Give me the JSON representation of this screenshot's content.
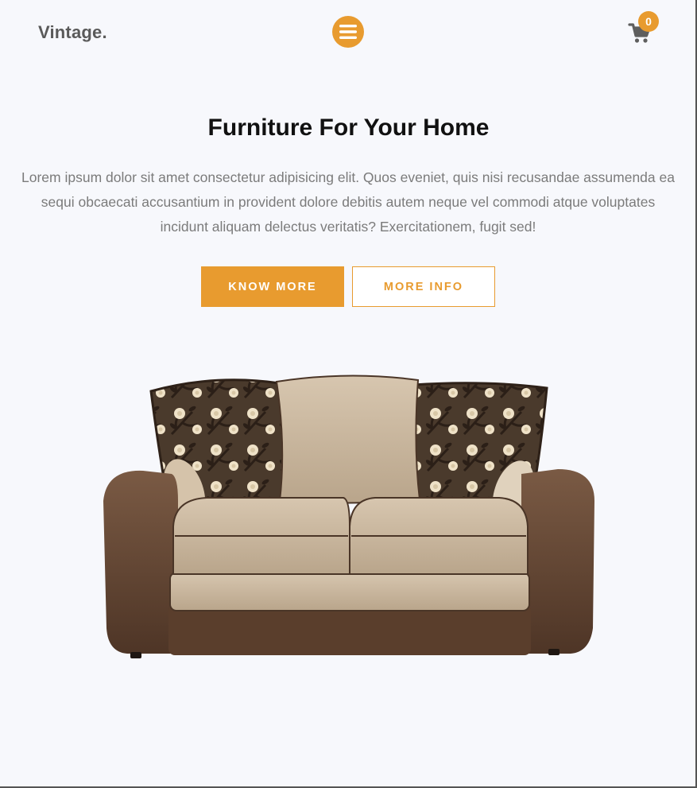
{
  "header": {
    "logo": "Vintage.",
    "menu_icon": "hamburger-menu-icon",
    "cart_icon": "shopping-cart-icon",
    "cart_count": "0"
  },
  "hero": {
    "title": "Furniture For Your Home",
    "text": "Lorem ipsum dolor sit amet consectetur adipisicing elit. Quos eveniet, quis nisi recusandae assumenda ea sequi obcaecati accusantium in provident dolore debitis autem neque vel commodi atque voluptates incidunt aliquam delectus veritatis? Exercitationem, fugit sed!",
    "primary_button": "KNOW MORE",
    "secondary_button": "MORE INFO",
    "image": "sofa-image"
  },
  "colors": {
    "accent": "#e89b2f",
    "background": "#f7f8fc",
    "title": "#111111",
    "body_text": "#7b7b7b",
    "logo": "#5a5a5a"
  }
}
